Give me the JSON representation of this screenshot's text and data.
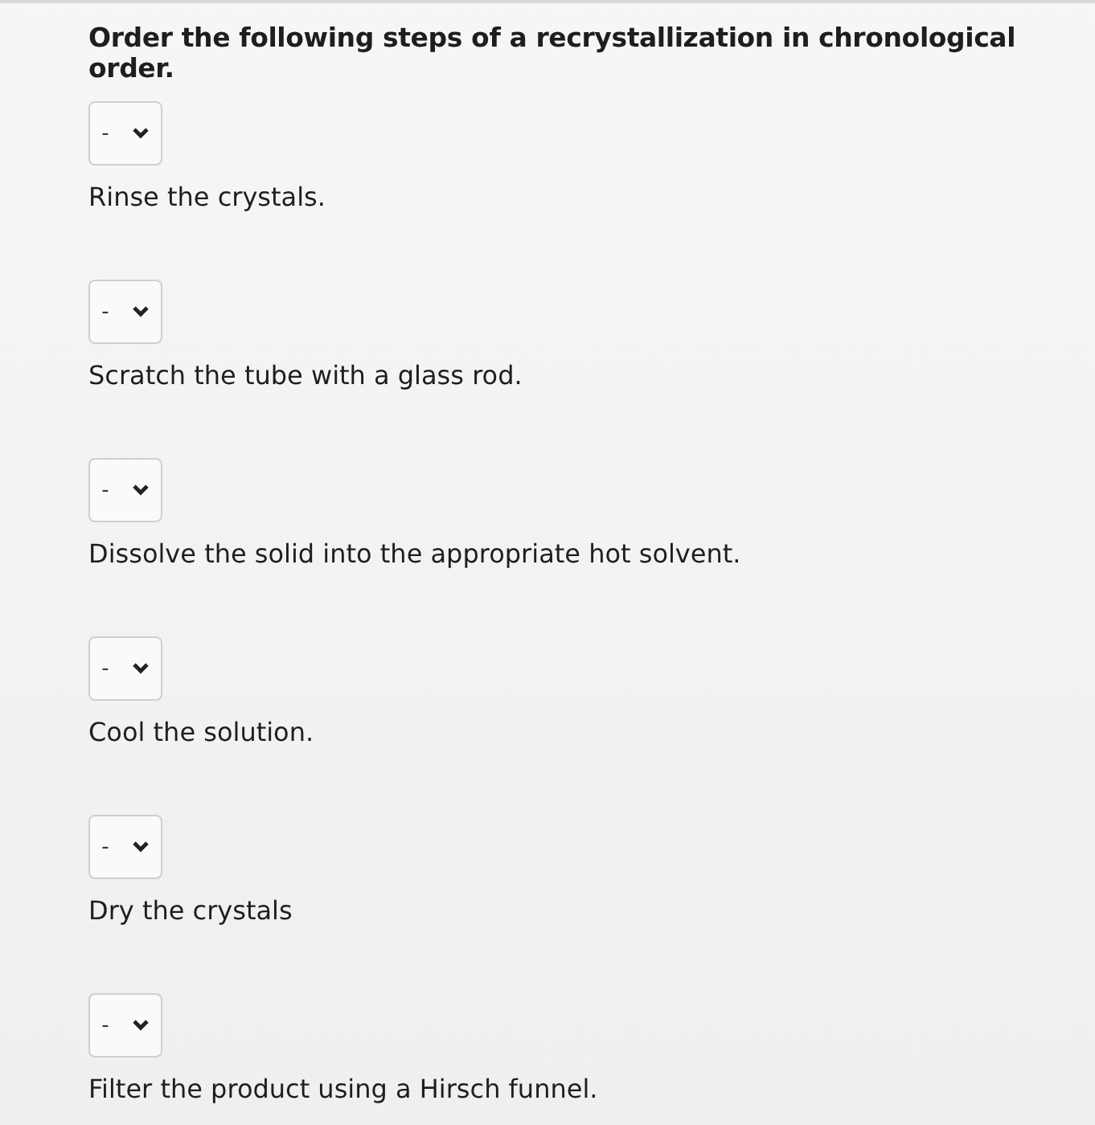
{
  "question": "Order the following steps of a recrystallization in chronological order.",
  "steps": [
    {
      "dropdown_value": "-",
      "text": "Rinse the crystals."
    },
    {
      "dropdown_value": "-",
      "text": "Scratch the tube with a glass rod."
    },
    {
      "dropdown_value": "-",
      "text": "Dissolve the solid into the appropriate hot solvent."
    },
    {
      "dropdown_value": "-",
      "text": "Cool the solution."
    },
    {
      "dropdown_value": "-",
      "text": "Dry the crystals"
    },
    {
      "dropdown_value": "-",
      "text": "Filter the product using a Hirsch funnel."
    }
  ]
}
